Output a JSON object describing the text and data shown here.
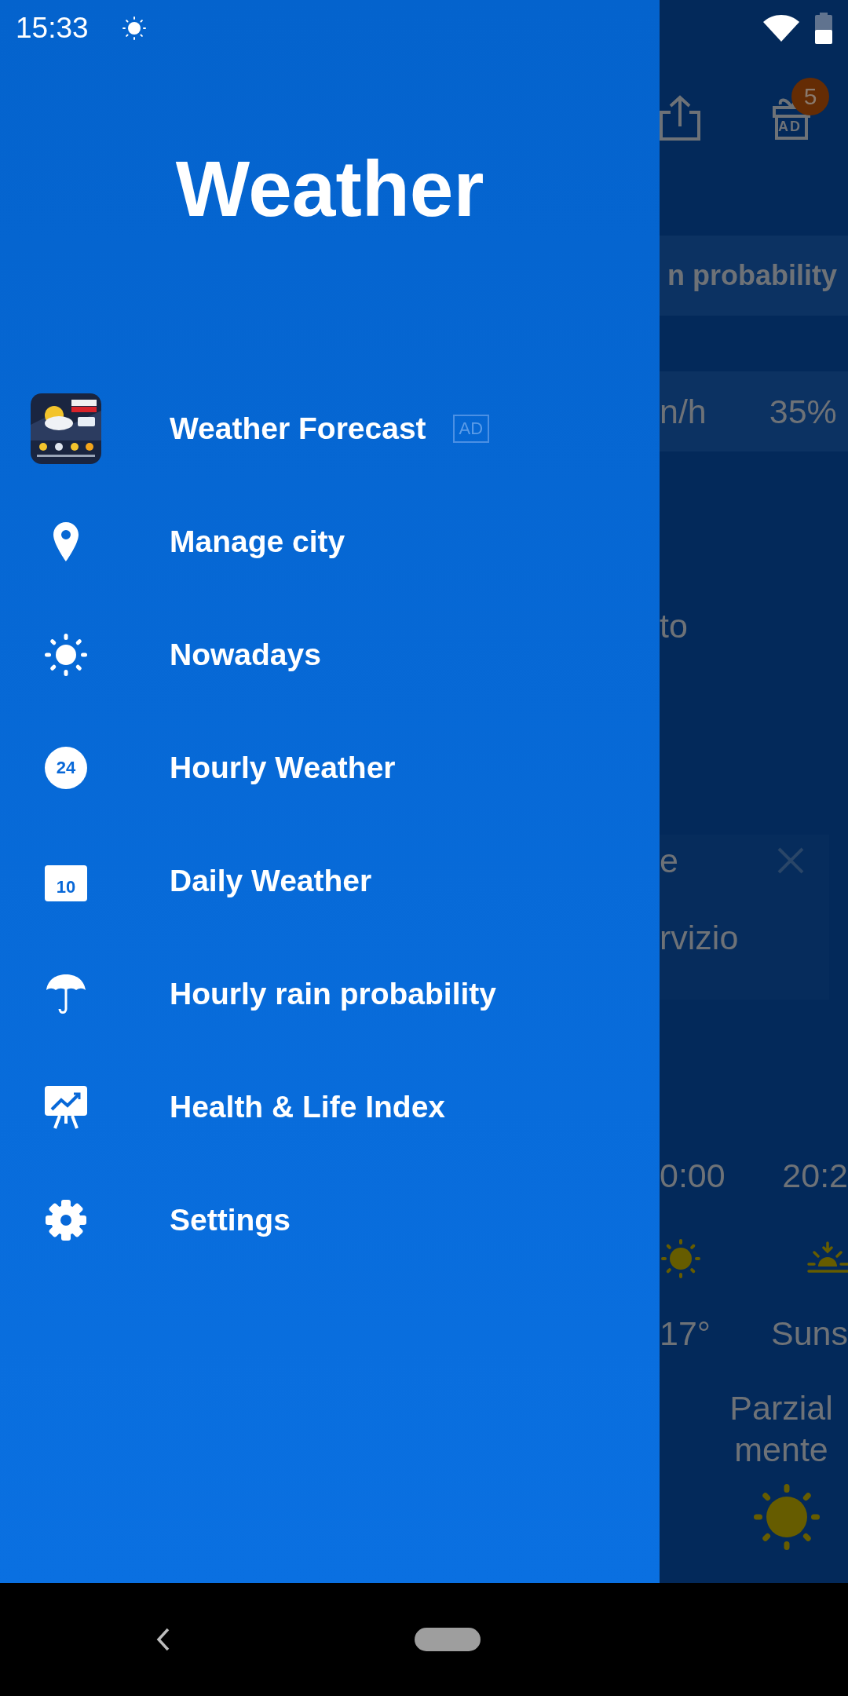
{
  "status_bar": {
    "time": "15:33"
  },
  "drawer": {
    "title": "Weather",
    "items": [
      {
        "kind": "app",
        "label": "Weather Forecast",
        "badge": "AD"
      },
      {
        "kind": "pin",
        "label": "Manage city"
      },
      {
        "kind": "sun",
        "label": "Nowadays"
      },
      {
        "kind": "clock",
        "label": "Hourly Weather",
        "icon_text": "24"
      },
      {
        "kind": "calendar",
        "label": "Daily Weather",
        "icon_text": "10"
      },
      {
        "kind": "umbrella",
        "label": "Hourly rain probability"
      },
      {
        "kind": "chart",
        "label": "Health & Life Index"
      },
      {
        "kind": "gear",
        "label": "Settings"
      }
    ]
  },
  "background": {
    "gift_label": "AD",
    "badge": "5",
    "header": "n probability",
    "wind": "n/h",
    "humidity": "35%",
    "line": "to",
    "card": {
      "line_1": "e",
      "line_2": "rvizio"
    },
    "times": [
      "0:00",
      "20:2"
    ],
    "labels": [
      "17°",
      "Suns"
    ],
    "condition": [
      "Parzial",
      "mente"
    ]
  }
}
